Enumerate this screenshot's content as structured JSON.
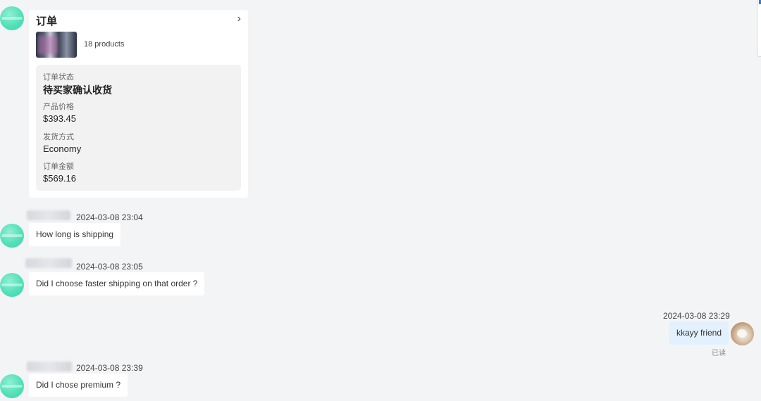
{
  "order_card": {
    "title": "订单",
    "products_count": "18 products",
    "fields": [
      {
        "label": "订单状态",
        "value": "待买家确认收货"
      },
      {
        "label": "产品价格",
        "value": "$393.45"
      },
      {
        "label": "发货方式",
        "value": "Economy"
      },
      {
        "label": "订单金额",
        "value": "$569.16"
      }
    ],
    "chevron_icon": "chevron-right-icon"
  },
  "messages": [
    {
      "timestamp": "2024-03-08 23:04",
      "text": "How long is shipping",
      "side": "left"
    },
    {
      "timestamp": "2024-03-08 23:05",
      "text": "Did I choose faster shipping on that order ?",
      "side": "left"
    },
    {
      "timestamp": "2024-03-08 23:29",
      "text": "kkayy friend",
      "side": "right",
      "status": "已读"
    },
    {
      "timestamp": "2024-03-08 23:39",
      "text": "Did I chose premium ?",
      "side": "left"
    }
  ],
  "colors": {
    "background": "#f3f4f6",
    "bubble_incoming": "#ffffff",
    "bubble_outgoing": "#e3f0fd",
    "avatar_accent": "#52e0b8",
    "detail_box": "#f2f2f2"
  }
}
